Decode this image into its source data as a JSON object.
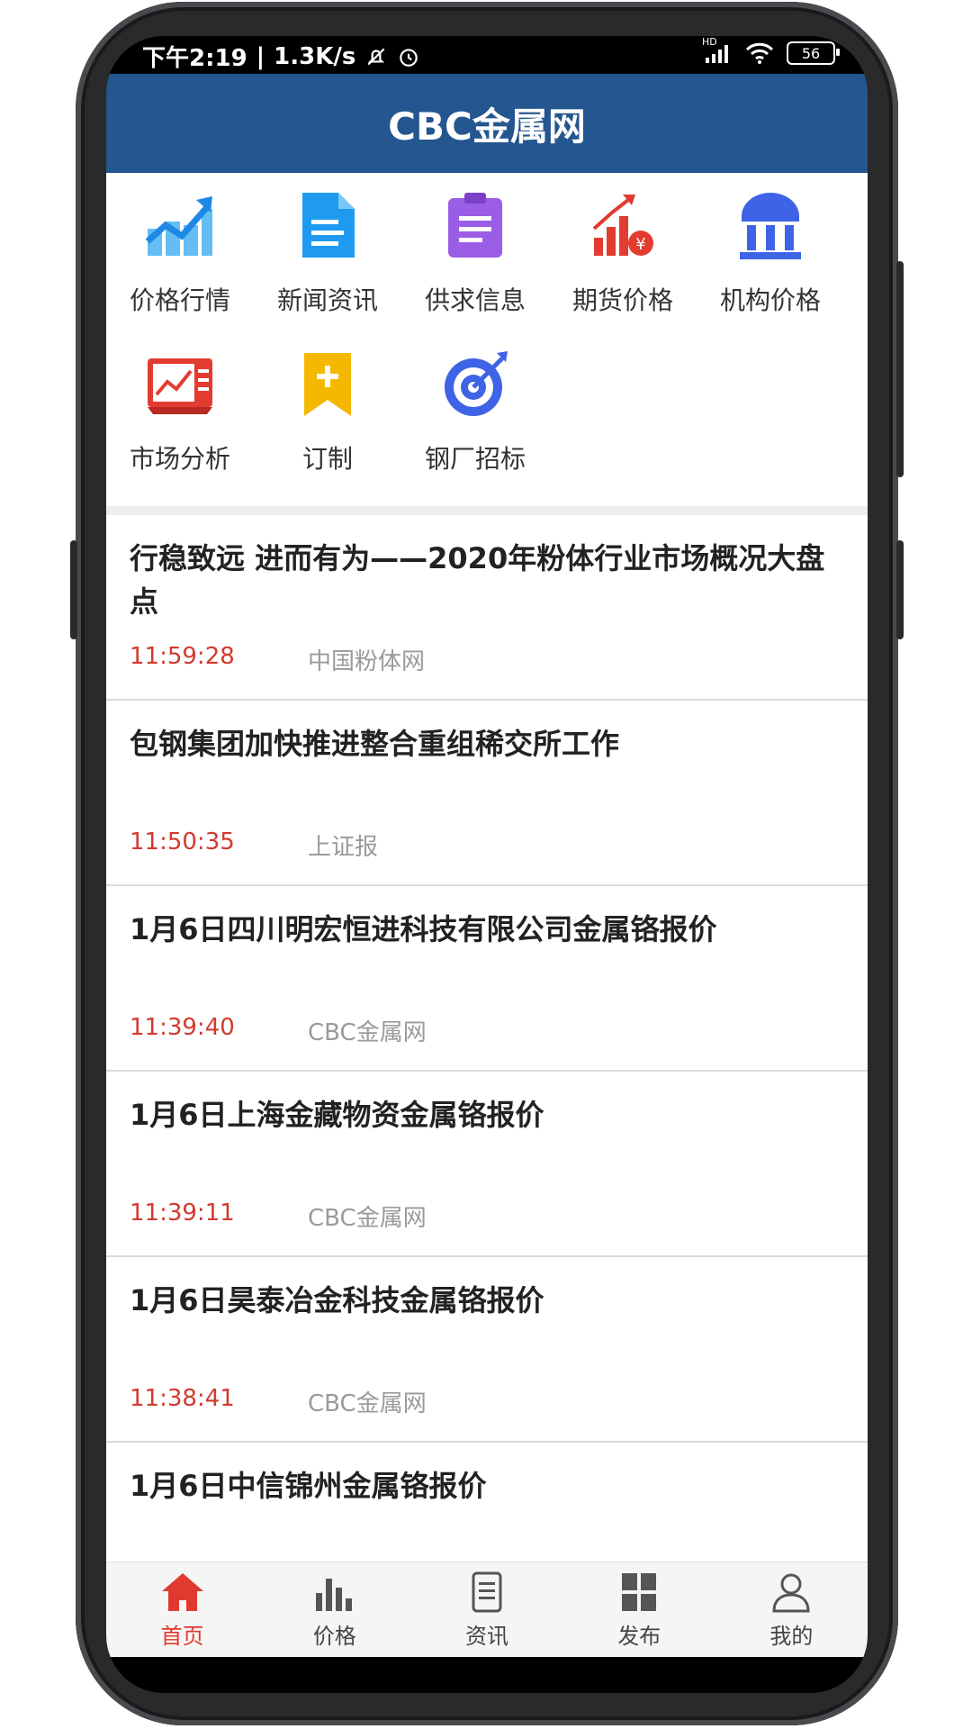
{
  "status_bar": {
    "time": "下午2:19",
    "speed": "1.3K/s",
    "hd": "HD",
    "battery": "56"
  },
  "header": {
    "title": "CBC金属网"
  },
  "menu": {
    "items": [
      {
        "label": "价格行情",
        "icon": "price-trend-icon",
        "color": "#1e9bf0"
      },
      {
        "label": "新闻资讯",
        "icon": "news-doc-icon",
        "color": "#1e9bf0"
      },
      {
        "label": "供求信息",
        "icon": "supply-clipboard-icon",
        "color": "#8a4fe0"
      },
      {
        "label": "期货价格",
        "icon": "futures-chart-icon",
        "color": "#e23b30"
      },
      {
        "label": "机构价格",
        "icon": "institution-building-icon",
        "color": "#3f63e6"
      },
      {
        "label": "市场分析",
        "icon": "market-analysis-icon",
        "color": "#e23b30"
      },
      {
        "label": "订制",
        "icon": "bookmark-plus-icon",
        "color": "#f5b800"
      },
      {
        "label": "钢厂招标",
        "icon": "target-icon",
        "color": "#3f63e6"
      }
    ]
  },
  "news": [
    {
      "title": "行稳致远 进而有为——2020年粉体行业市场概况大盘点",
      "time": "11:59:28",
      "source": "中国粉体网"
    },
    {
      "title": "包钢集团加快推进整合重组稀交所工作",
      "time": "11:50:35",
      "source": "上证报"
    },
    {
      "title": "1月6日四川明宏恒进科技有限公司金属铬报价",
      "time": "11:39:40",
      "source": "CBC金属网"
    },
    {
      "title": "1月6日上海金藏物资金属铬报价",
      "time": "11:39:11",
      "source": "CBC金属网"
    },
    {
      "title": "1月6日昊泰冶金科技金属铬报价",
      "time": "11:38:41",
      "source": "CBC金属网"
    },
    {
      "title": "1月6日中信锦州金属铬报价",
      "time": "",
      "source": ""
    }
  ],
  "tabs": [
    {
      "label": "首页",
      "icon": "home-icon",
      "active": true
    },
    {
      "label": "价格",
      "icon": "bar-chart-icon",
      "active": false
    },
    {
      "label": "资讯",
      "icon": "document-icon",
      "active": false
    },
    {
      "label": "发布",
      "icon": "grid-icon",
      "active": false
    },
    {
      "label": "我的",
      "icon": "user-icon",
      "active": false
    }
  ],
  "colors": {
    "header": "#24568f",
    "accent": "#e03a2e",
    "time": "#d23a2e"
  }
}
